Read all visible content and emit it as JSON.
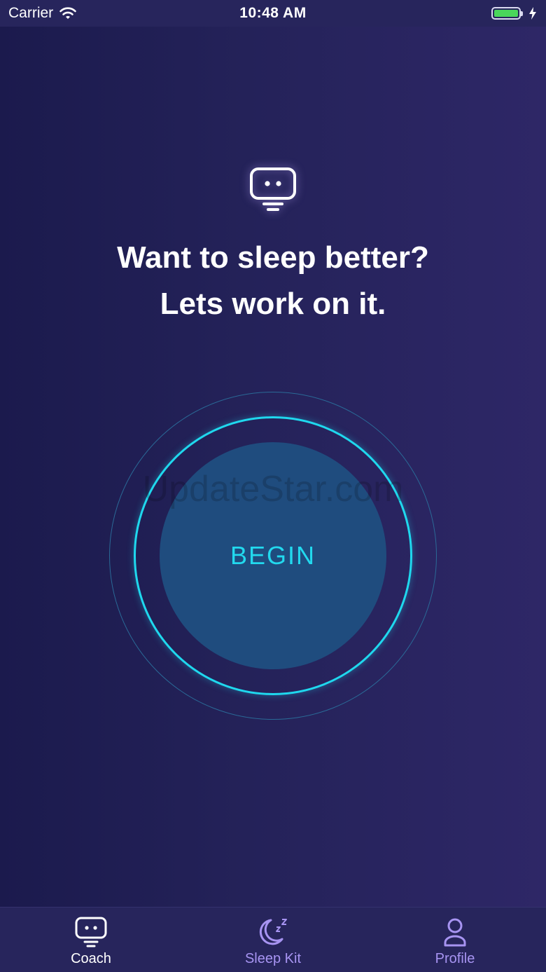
{
  "status_bar": {
    "carrier": "Carrier",
    "time": "10:48 AM",
    "wifi_icon": "wifi-icon",
    "battery_icon": "battery-icon",
    "charging_icon": "charging-bolt-icon",
    "battery_level": 1.0
  },
  "main": {
    "icon": "coach-bot-icon",
    "headline_line1": "Want to sleep better?",
    "headline_line2": "Lets work on it.",
    "begin_label": "BEGIN",
    "watermark": "UpdateStar.com"
  },
  "tab_bar": {
    "tabs": [
      {
        "label": "Coach",
        "icon": "coach-bot-icon",
        "active": true
      },
      {
        "label": "Sleep Kit",
        "icon": "moon-zz-icon",
        "active": false
      },
      {
        "label": "Profile",
        "icon": "person-icon",
        "active": false
      }
    ]
  },
  "colors": {
    "background_start": "#1b1a4d",
    "background_end": "#2e2767",
    "accent_cyan": "#1fd8ee",
    "button_fill": "#1f4c7e",
    "inactive_tab": "#a794f2",
    "battery_green": "#4ad65b"
  }
}
